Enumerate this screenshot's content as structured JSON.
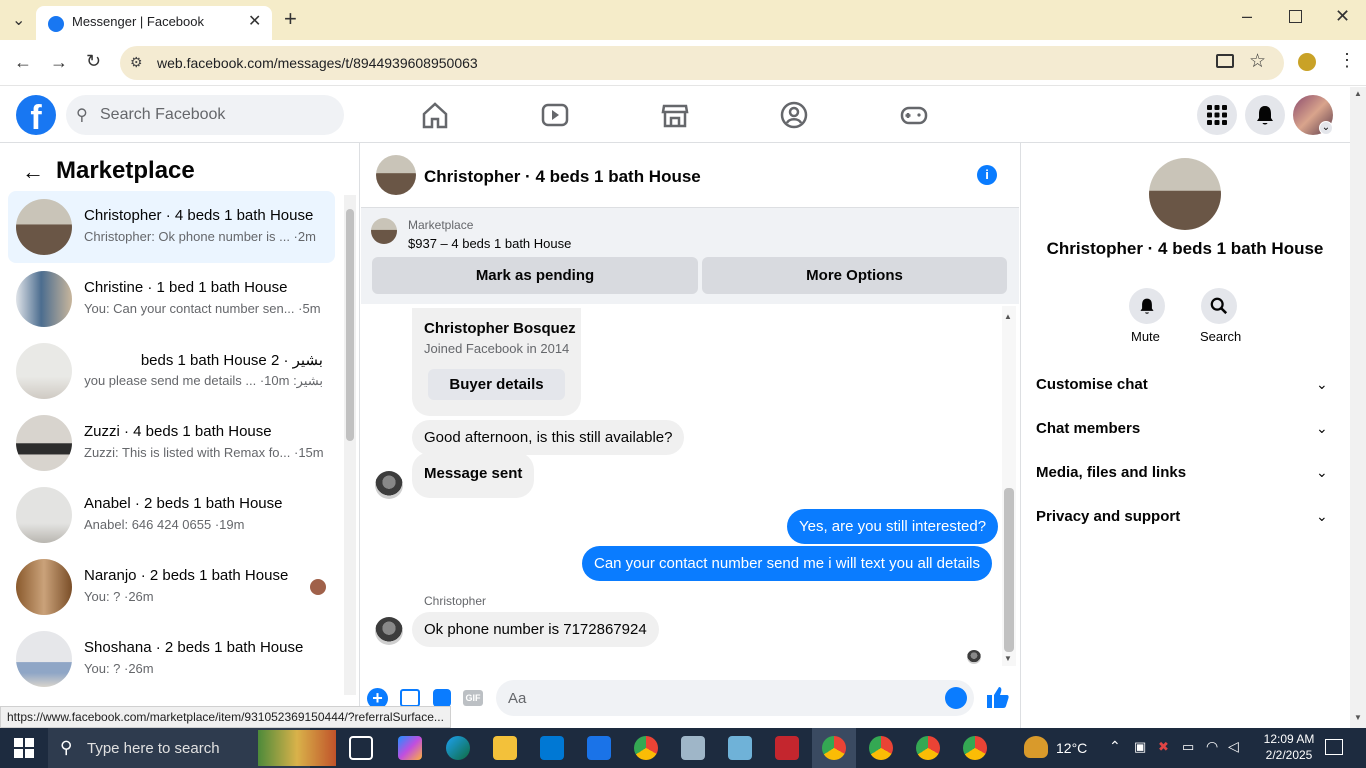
{
  "browser": {
    "tab_title": "Messenger | Facebook",
    "url": "web.facebook.com/messages/t/8944939608950063",
    "status_url": "https://www.facebook.com/marketplace/item/931052369150444/?referralSurface..."
  },
  "fb": {
    "search_placeholder": "Search Facebook"
  },
  "sidebar": {
    "title": "Marketplace",
    "conversations": [
      {
        "title": "Christopher · 4 beds 1 bath House",
        "preview": "Christopher: Ok phone number is ... ·2m"
      },
      {
        "title": "Christine · 1 bed 1 bath House",
        "preview": "You: Can your contact number sen... ·5m"
      },
      {
        "title": "بشير · 2 beds 1 bath House",
        "preview": "بشير: you please send me details ... ·10m"
      },
      {
        "title": "Zuzzi · 4 beds 1 bath House",
        "preview": "Zuzzi: This is listed with Remax fo... ·15m"
      },
      {
        "title": "Anabel · 2 beds 1 bath House",
        "preview": "Anabel: 646 424 0655 ·19m"
      },
      {
        "title": "Naranjo · 2 beds 1 bath House",
        "preview": "You: ? ·26m"
      },
      {
        "title": "Shoshana · 2 beds 1 bath House",
        "preview": "You: ? ·26m"
      }
    ]
  },
  "chat": {
    "title": "Christopher · 4 beds 1 bath House",
    "banner": {
      "label": "Marketplace",
      "item": "$937 – 4 beds 1 bath House"
    },
    "mark_pending": "Mark as pending",
    "more_options": "More Options",
    "profile_card": {
      "name": "Christopher Bosquez",
      "joined": "Joined Facebook in 2014",
      "button": "Buyer details"
    },
    "messages": {
      "m1": "Good afternoon, is this still available?",
      "m2": "Message sent",
      "m3": "Yes, are you still interested?",
      "m4": "Can your contact number send me i will text you all details",
      "sender": "Christopher",
      "m5": "Ok phone number is 7172867924"
    },
    "composer_placeholder": "Aa"
  },
  "info": {
    "title": "Christopher · 4 beds 1 bath House",
    "mute": "Mute",
    "search": "Search",
    "sections": [
      "Customise chat",
      "Chat members",
      "Media, files and links",
      "Privacy and support"
    ]
  },
  "taskbar": {
    "search_placeholder": "Type here to search",
    "weather": "12°C",
    "time": "12:09 AM",
    "date": "2/2/2025"
  },
  "colors": {
    "accent": "#0a7cff",
    "fb_blue": "#1877f2"
  }
}
